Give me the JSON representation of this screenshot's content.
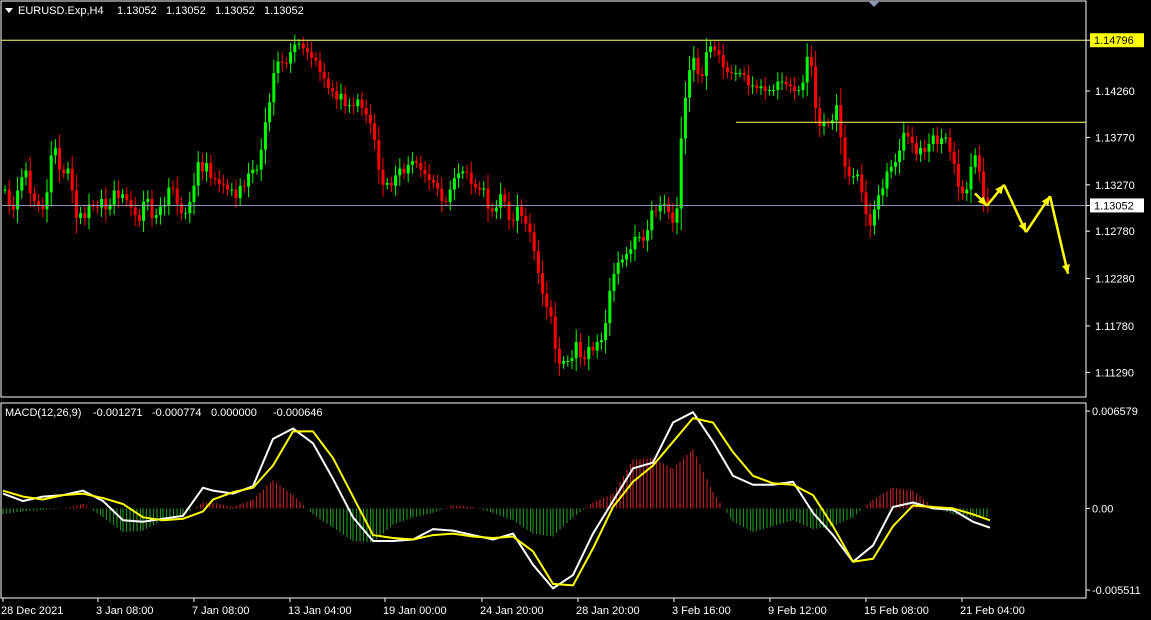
{
  "colors": {
    "background": "#000000",
    "bull": "#00ff00",
    "bear": "#ff0000",
    "border": "#ffffff",
    "level_line": "#ffff66",
    "current_line": "#8c96b4",
    "arrow": "#ffff00",
    "macd_line": "#ffffff",
    "signal_line": "#ffff00",
    "hist_pos": "#b32222",
    "hist_neg": "#228b22"
  },
  "chart_data": [
    {
      "type": "candlestick",
      "title": "EURUSD.Exp,H4",
      "ohlc": [
        "1.13052",
        "1.13052",
        "1.13052",
        "1.13052"
      ],
      "y_ticks": [
        "1.14796",
        "1.14260",
        "1.13770",
        "1.13270",
        "1.13052",
        "1.12780",
        "1.12280",
        "1.11780",
        "1.11290"
      ],
      "ylim": [
        1.1103,
        1.1521
      ],
      "x_ticks": [
        "28 Dec 2021",
        "3 Jan 08:00",
        "7 Jan 08:00",
        "13 Jan 04:00",
        "19 Jan 00:00",
        "24 Jan 20:00",
        "28 Jan 20:00",
        "3 Feb 16:00",
        "9 Feb 12:00",
        "15 Feb 08:00",
        "21 Feb 04:00"
      ],
      "current_price": 1.13052,
      "levels": [
        1.14796,
        1.1393
      ],
      "forecast_path": [
        1.1318,
        1.1305,
        1.1327,
        1.1277,
        1.1315,
        1.1233
      ],
      "closes": [
        1.1322,
        1.1306,
        1.1301,
        1.1321,
        1.1335,
        1.1342,
        1.1318,
        1.131,
        1.1305,
        1.1301,
        1.1319,
        1.1358,
        1.1366,
        1.1343,
        1.1339,
        1.1344,
        1.1321,
        1.1292,
        1.1297,
        1.1292,
        1.1306,
        1.1304,
        1.1303,
        1.1312,
        1.1301,
        1.1306,
        1.1321,
        1.1313,
        1.1317,
        1.1311,
        1.1303,
        1.1295,
        1.1289,
        1.1309,
        1.1312,
        1.1292,
        1.1295,
        1.1304,
        1.1305,
        1.1324,
        1.1323,
        1.1307,
        1.1297,
        1.1297,
        1.1309,
        1.1326,
        1.1351,
        1.1341,
        1.135,
        1.1334,
        1.1333,
        1.1328,
        1.1327,
        1.1322,
        1.1322,
        1.1313,
        1.1326,
        1.1325,
        1.1339,
        1.1343,
        1.1343,
        1.1364,
        1.1393,
        1.1414,
        1.1445,
        1.1457,
        1.1456,
        1.1455,
        1.1467,
        1.1475,
        1.1476,
        1.1471,
        1.1467,
        1.1461,
        1.1458,
        1.1446,
        1.1439,
        1.1429,
        1.1426,
        1.1417,
        1.1423,
        1.141,
        1.1411,
        1.141,
        1.1417,
        1.1408,
        1.1401,
        1.1392,
        1.1374,
        1.1343,
        1.1327,
        1.1329,
        1.1326,
        1.1337,
        1.1344,
        1.1339,
        1.1348,
        1.1352,
        1.135,
        1.1343,
        1.1338,
        1.1332,
        1.1329,
        1.1323,
        1.131,
        1.1309,
        1.1322,
        1.1334,
        1.1339,
        1.1341,
        1.134,
        1.1328,
        1.1324,
        1.1322,
        1.1323,
        1.1302,
        1.1299,
        1.1303,
        1.1317,
        1.1309,
        1.129,
        1.1289,
        1.1304,
        1.1294,
        1.1286,
        1.1277,
        1.1257,
        1.1234,
        1.1212,
        1.1198,
        1.1188,
        1.1154,
        1.1138,
        1.1141,
        1.1141,
        1.1144,
        1.1161,
        1.1145,
        1.1143,
        1.1156,
        1.1152,
        1.1161,
        1.1163,
        1.1181,
        1.1215,
        1.1233,
        1.1245,
        1.1248,
        1.1254,
        1.1259,
        1.1272,
        1.1272,
        1.1268,
        1.1279,
        1.13,
        1.1299,
        1.1306,
        1.1307,
        1.1298,
        1.1287,
        1.1302,
        1.1376,
        1.1419,
        1.1448,
        1.1461,
        1.1444,
        1.1442,
        1.1467,
        1.1473,
        1.1469,
        1.1464,
        1.1451,
        1.1446,
        1.1445,
        1.1445,
        1.1445,
        1.1443,
        1.1432,
        1.1432,
        1.1429,
        1.1431,
        1.1426,
        1.1427,
        1.1427,
        1.1436,
        1.1436,
        1.1433,
        1.1431,
        1.1426,
        1.1427,
        1.1435,
        1.1462,
        1.1452,
        1.1408,
        1.1389,
        1.1393,
        1.1392,
        1.1395,
        1.1411,
        1.1377,
        1.1346,
        1.1336,
        1.1336,
        1.1338,
        1.1319,
        1.1296,
        1.1284,
        1.1301,
        1.1316,
        1.1323,
        1.1341,
        1.1346,
        1.1351,
        1.1363,
        1.1382,
        1.1378,
        1.1371,
        1.1359,
        1.1366,
        1.1362,
        1.137,
        1.1379,
        1.137,
        1.1376,
        1.1377,
        1.1362,
        1.1349,
        1.1325,
        1.1318,
        1.1322,
        1.1346,
        1.1358,
        1.1341,
        1.1313,
        1.1308
      ],
      "low": 1.1121,
      "high": 1.149
    },
    {
      "type": "macd",
      "title": "MACD(12,26,9)",
      "params": [
        "-0.001271",
        "-0.000774",
        "0.000000",
        "-0.000646"
      ],
      "y_ticks": [
        "0.006579",
        "0.00",
        "-0.005511"
      ],
      "ylim": [
        -0.00605,
        0.00712
      ],
      "series": [
        {
          "name": "MACD",
          "x": [
            0,
            20,
            40,
            60,
            80,
            100,
            120,
            140,
            160,
            180,
            200,
            210,
            230,
            250,
            270,
            290,
            310,
            330,
            350,
            370,
            390,
            410,
            430,
            450,
            470,
            490,
            510,
            530,
            550,
            570,
            590,
            610,
            630,
            650,
            670,
            690,
            710,
            730,
            750,
            770,
            790,
            810,
            830,
            850,
            870,
            890,
            910,
            930,
            950,
            970,
            987
          ],
          "y": [
            0.001,
            0.0005,
            0.0008,
            0.0009,
            0.0012,
            0.0005,
            -0.0008,
            -0.0009,
            -0.0007,
            -0.0005,
            0.0014,
            0.0012,
            0.001,
            0.0015,
            0.0047,
            0.0054,
            0.0044,
            0.002,
            -0.0006,
            -0.0022,
            -0.0022,
            -0.0021,
            -0.0014,
            -0.0015,
            -0.0018,
            -0.0021,
            -0.0017,
            -0.0038,
            -0.0054,
            -0.0045,
            -0.0017,
            0.0005,
            0.0027,
            0.0031,
            0.0058,
            0.0065,
            0.0045,
            0.0022,
            0.0016,
            0.0016,
            0.0018,
            -0.0003,
            -0.0018,
            -0.0036,
            -0.0025,
            0.0001,
            0.0004,
            0.0,
            -0.0001,
            -0.0009,
            -0.0013
          ]
        },
        {
          "name": "Signal",
          "x": [
            0,
            20,
            40,
            60,
            80,
            100,
            120,
            140,
            160,
            180,
            200,
            210,
            230,
            250,
            270,
            290,
            310,
            330,
            350,
            370,
            390,
            410,
            430,
            450,
            470,
            490,
            510,
            530,
            550,
            570,
            590,
            610,
            630,
            650,
            670,
            690,
            710,
            730,
            750,
            770,
            790,
            810,
            830,
            850,
            870,
            890,
            910,
            930,
            950,
            970,
            987
          ],
          "y": [
            0.0012,
            0.0008,
            0.0006,
            0.0009,
            0.001,
            0.0007,
            0.0003,
            -0.0006,
            -0.0008,
            -0.0007,
            -0.0002,
            0.0006,
            0.0011,
            0.0014,
            0.0029,
            0.0052,
            0.0052,
            0.0034,
            0.0008,
            -0.0018,
            -0.002,
            -0.0021,
            -0.0018,
            -0.0017,
            -0.0019,
            -0.002,
            -0.0019,
            -0.0029,
            -0.0051,
            -0.0052,
            -0.0027,
            0.0001,
            0.0018,
            0.0029,
            0.0045,
            0.0061,
            0.0058,
            0.0038,
            0.0022,
            0.0017,
            0.0016,
            0.0009,
            -0.0012,
            -0.0036,
            -0.0034,
            -0.0012,
            0.0002,
            0.0001,
            0.0,
            -0.0004,
            -0.0008
          ]
        },
        {
          "name": "Histogram",
          "x": [
            0,
            20,
            40,
            60,
            80,
            100,
            120,
            140,
            160,
            180,
            200,
            210,
            230,
            250,
            270,
            290,
            310,
            330,
            350,
            370,
            390,
            410,
            430,
            450,
            470,
            490,
            510,
            530,
            550,
            570,
            590,
            610,
            630,
            650,
            670,
            690,
            710,
            730,
            750,
            770,
            790,
            810,
            830,
            850,
            870,
            890,
            910,
            930,
            950,
            970,
            987
          ],
          "y": [
            -0.0004,
            -0.0002,
            -0.0001,
            0.0,
            0.0003,
            -0.0006,
            -0.0016,
            -0.0015,
            -0.0008,
            -0.0005,
            0.0004,
            0.0004,
            0.0001,
            0.0006,
            0.0019,
            0.0009,
            -0.0004,
            -0.0013,
            -0.0022,
            -0.0023,
            -0.0011,
            -0.0006,
            -0.0003,
            0.0002,
            0.0001,
            -0.0003,
            -0.0008,
            -0.0017,
            -0.0019,
            -0.0006,
            0.0004,
            0.001,
            0.0033,
            0.0034,
            0.0027,
            0.004,
            0.0011,
            -0.0009,
            -0.0016,
            -0.0012,
            -0.0008,
            -0.0014,
            -0.0012,
            -0.0006,
            0.0006,
            0.0014,
            0.0012,
            0.0001,
            -0.0004,
            -0.0006,
            -0.0006
          ]
        }
      ]
    }
  ]
}
